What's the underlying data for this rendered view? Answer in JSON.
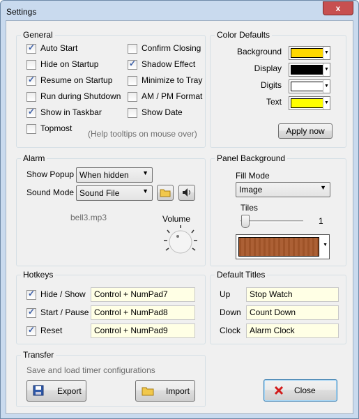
{
  "window": {
    "title": "Settings",
    "close_glyph": "x"
  },
  "general": {
    "title": "General",
    "options": [
      {
        "label": "Auto Start",
        "checked": true
      },
      {
        "label": "Hide on Startup",
        "checked": false
      },
      {
        "label": "Resume on Startup",
        "checked": true
      },
      {
        "label": "Run during Shutdown",
        "checked": false
      },
      {
        "label": "Show in Taskbar",
        "checked": true
      },
      {
        "label": "Topmost",
        "checked": false
      },
      {
        "label": "Confirm Closing",
        "checked": false
      },
      {
        "label": "Shadow Effect",
        "checked": true
      },
      {
        "label": "Minimize to Tray",
        "checked": false
      },
      {
        "label": "AM / PM Format",
        "checked": false
      },
      {
        "label": "Show Date",
        "checked": false
      }
    ],
    "hint": "(Help tooltips on mouse over)"
  },
  "color_defaults": {
    "title": "Color Defaults",
    "items": [
      {
        "label": "Background",
        "color": "#ffd800"
      },
      {
        "label": "Display",
        "color": "#000000"
      },
      {
        "label": "Digits",
        "color": "#ffffff"
      },
      {
        "label": "Text",
        "color": "#ffff00"
      }
    ],
    "apply_label": "Apply now"
  },
  "alarm": {
    "title": "Alarm",
    "show_popup_label": "Show Popup",
    "show_popup_value": "When hidden",
    "sound_mode_label": "Sound Mode",
    "sound_mode_value": "Sound File",
    "file_name": "bell3.mp3",
    "volume_label": "Volume"
  },
  "panel_background": {
    "title": "Panel Background",
    "fill_mode_label": "Fill Mode",
    "fill_mode_value": "Image",
    "tiles_label": "Tiles",
    "tiles_value": "1",
    "preview_color": "#a8582a"
  },
  "hotkeys": {
    "title": "Hotkeys",
    "items": [
      {
        "label": "Hide / Show",
        "checked": true,
        "value": "Control + NumPad7"
      },
      {
        "label": "Start / Pause",
        "checked": true,
        "value": "Control + NumPad8"
      },
      {
        "label": "Reset",
        "checked": true,
        "value": "Control + NumPad9"
      }
    ]
  },
  "default_titles": {
    "title": "Default Titles",
    "items": [
      {
        "label": "Up",
        "value": "Stop Watch"
      },
      {
        "label": "Down",
        "value": "Count Down"
      },
      {
        "label": "Clock",
        "value": "Alarm Clock"
      }
    ]
  },
  "transfer": {
    "title": "Transfer",
    "description": "Save and load timer configurations",
    "export_label": "Export",
    "import_label": "Import"
  },
  "close_label": "Close"
}
